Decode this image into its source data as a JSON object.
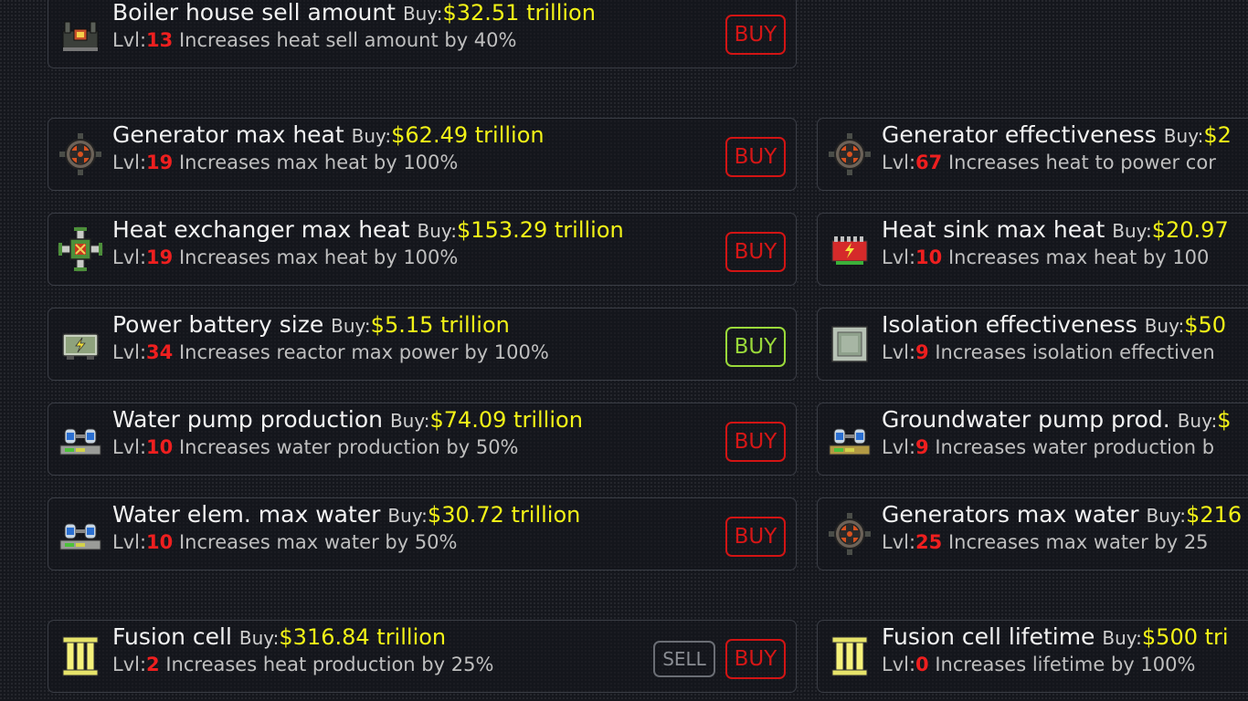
{
  "colors": {
    "price": "#f3f317",
    "level": "#ee1f1f",
    "buy_disabled": "#d21414",
    "buy_affordable": "#9ad93a"
  },
  "buy_prefix": "Buy:",
  "lvl_prefix": "Lvl:",
  "buy_label": "BUY",
  "sell_label": "SELL",
  "upgrades_left": [
    {
      "icon": "boiler-house-icon",
      "name": "Boiler house sell amount",
      "price": "$32.51 trillion",
      "level": "13",
      "desc": "Increases heat sell amount by 40%",
      "affordable": false
    },
    {
      "icon": "generator-icon",
      "name": "Generator max heat",
      "price": "$62.49 trillion",
      "level": "19",
      "desc": "Increases max heat by 100%",
      "affordable": false
    },
    {
      "icon": "heat-exchanger-icon",
      "name": "Heat exchanger max heat",
      "price": "$153.29 trillion",
      "level": "19",
      "desc": "Increases max heat by 100%",
      "affordable": false
    },
    {
      "icon": "battery-icon",
      "name": "Power battery size",
      "price": "$5.15 trillion",
      "level": "34",
      "desc": "Increases reactor max power by 100%",
      "affordable": true
    },
    {
      "icon": "water-pump-icon",
      "name": "Water pump production",
      "price": "$74.09 trillion",
      "level": "10",
      "desc": "Increases water production by 50%",
      "affordable": false
    },
    {
      "icon": "water-element-icon",
      "name": "Water elem. max water",
      "price": "$30.72 trillion",
      "level": "10",
      "desc": "Increases max water by 50%",
      "affordable": false
    },
    {
      "icon": "fusion-cell-icon",
      "name": "Fusion cell",
      "price": "$316.84 trillion",
      "level": "2",
      "desc": "Increases heat production by 25%",
      "affordable": false,
      "sellable": true
    }
  ],
  "upgrades_right": [
    {
      "icon": "generator-icon",
      "name": "Generator effectiveness",
      "price": "$2",
      "level": "67",
      "desc": "Increases heat to power cor"
    },
    {
      "icon": "heat-sink-icon",
      "name": "Heat sink max heat",
      "price": "$20.97",
      "level": "10",
      "desc": "Increases max heat by 100"
    },
    {
      "icon": "isolation-icon",
      "name": "Isolation effectiveness",
      "price": "$50",
      "level": "9",
      "desc": "Increases isolation effectiven"
    },
    {
      "icon": "groundwater-pump-icon",
      "name": "Groundwater pump prod.",
      "price": "$",
      "level": "9",
      "desc": "Increases water production b"
    },
    {
      "icon": "generator-icon",
      "name": "Generators max water",
      "price": "$216",
      "level": "25",
      "desc": "Increases max water by 25"
    },
    {
      "icon": "fusion-cell-icon",
      "name": "Fusion cell lifetime",
      "price": "$500 tri",
      "level": "0",
      "desc": "Increases lifetime by 100%"
    }
  ]
}
